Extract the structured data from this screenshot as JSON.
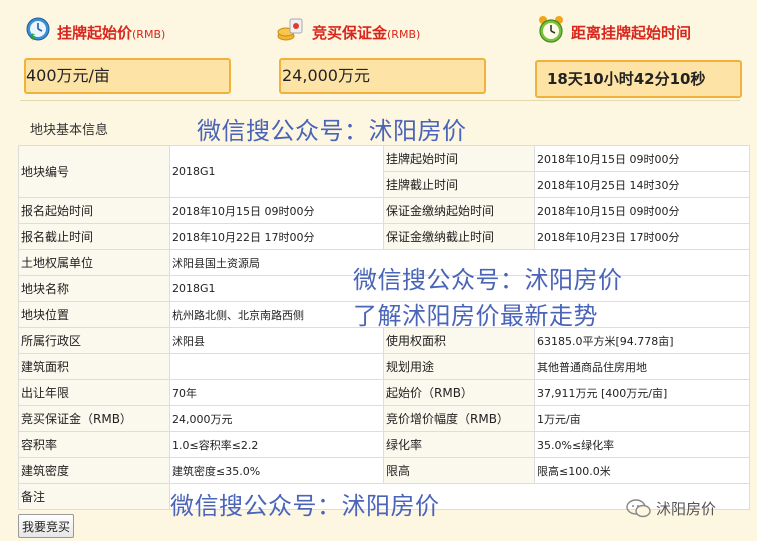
{
  "top": {
    "listing_price": {
      "label": "挂牌起始价",
      "unit": "(RMB)",
      "value": "400万元/亩"
    },
    "deposit": {
      "label": "竞买保证金",
      "unit": "(RMB)",
      "value": "24,000万元"
    },
    "countdown": {
      "label": "距离挂牌起始时间",
      "value": "18天10小时42分10秒"
    }
  },
  "section_title": "地块基本信息",
  "watermarks": {
    "line1": "微信搜公众号：沭阳房价",
    "line2": "微信搜公众号：沭阳房价",
    "line3": "了解沭阳房价最新走势",
    "line4": "微信搜公众号：沭阳房价"
  },
  "table": {
    "plot_no_label": "地块编号",
    "plot_no": "2018G1",
    "list_start_label": "挂牌起始时间",
    "list_start": "2018年10月15日 09时00分",
    "list_end_label": "挂牌截止时间",
    "list_end": "2018年10月25日 14时30分",
    "reg_start_label": "报名起始时间",
    "reg_start": "2018年10月15日 09时00分",
    "dep_start_label": "保证金缴纳起始时间",
    "dep_start": "2018年10月15日 09时00分",
    "reg_end_label": "报名截止时间",
    "reg_end": "2018年10月22日 17时00分",
    "dep_end_label": "保证金缴纳截止时间",
    "dep_end": "2018年10月23日 17时00分",
    "owner_label": "土地权属单位",
    "owner": "沭阳县国土资源局",
    "name_label": "地块名称",
    "name": "2018G1",
    "location_label": "地块位置",
    "location": "杭州路北侧、北京南路西侧",
    "district_label": "所属行政区",
    "district": "沭阳县",
    "area_label": "使用权面积",
    "area": "63185.0平方米[94.778亩]",
    "build_area_label": "建筑面积",
    "build_area": "",
    "usage_label": "规划用途",
    "usage": "其他普通商品住房用地",
    "term_label": "出让年限",
    "term": "70年",
    "start_price_label": "起始价（RMB）",
    "start_price": "37,911万元 [400万元/亩]",
    "deposit_label": "竞买保证金（RMB）",
    "deposit": "24,000万元",
    "increment_label": "竞价增价幅度（RMB）",
    "increment": "1万元/亩",
    "far_label": "容积率",
    "far": "1.0≤容积率≤2.2",
    "green_label": "绿化率",
    "green": "35.0%≤绿化率",
    "density_label": "建筑密度",
    "density": "建筑密度≤35.0%",
    "height_label": "限高",
    "height": "限高≤100.0米",
    "remark_label": "备注",
    "remark": ""
  },
  "buy_button": "我要竞买",
  "brand": "沭阳房价",
  "icons": {
    "price": "price-clock-icon",
    "deposit": "deposit-coins-icon",
    "countdown": "alarm-clock-icon",
    "brand": "wechat-icon"
  },
  "colors": {
    "label_red": "#d9261c",
    "box_fill": "#fde4a6",
    "box_border": "#f0b23c",
    "watermark_blue": "#4a64b8",
    "page_bg": "#fdf6e0"
  }
}
